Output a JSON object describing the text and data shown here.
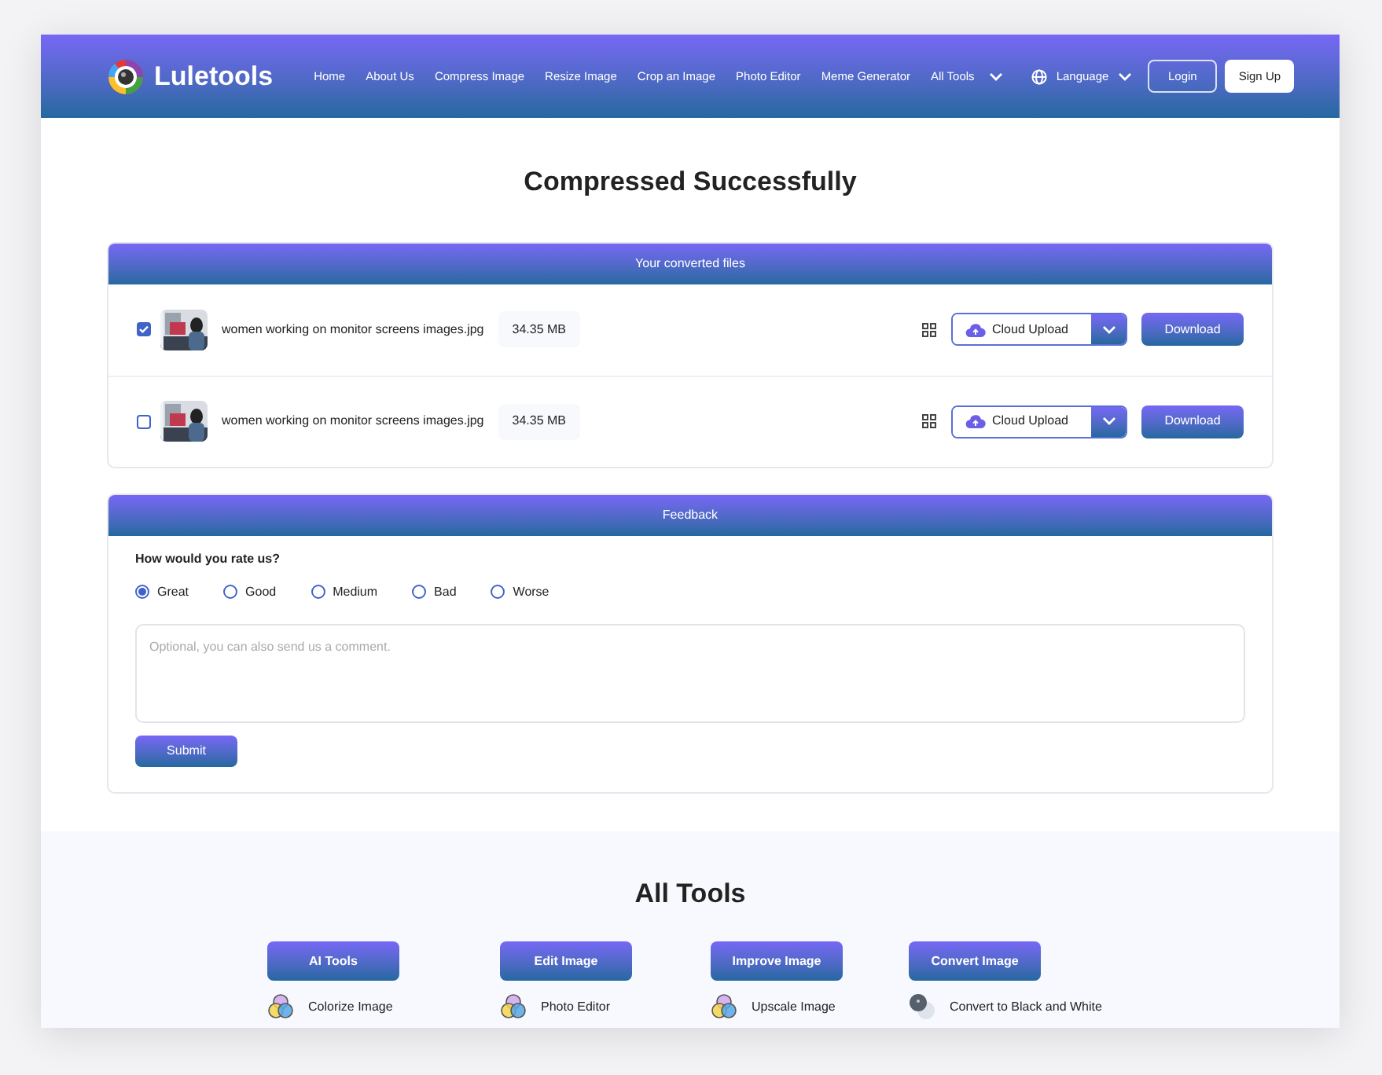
{
  "header": {
    "logo": "Luletools",
    "nav": [
      "Home",
      "About Us",
      "Compress Image",
      "Resize Image",
      "Crop an Image",
      "Photo Editor",
      "Meme Generator"
    ],
    "all_tools": "All Tools",
    "language": "Language",
    "login": "Login",
    "signup": "Sign Up"
  },
  "title": "Compressed Successfully",
  "files": {
    "heading": "Your converted files",
    "rows": [
      {
        "checked": true,
        "name": "women working on monitor screens images.jpg",
        "size": "34.35 MB",
        "upload": "Cloud Upload",
        "download": "Download"
      },
      {
        "checked": false,
        "name": "women working on monitor screens images.jpg",
        "size": "34.35 MB",
        "upload": "Cloud Upload",
        "download": "Download"
      }
    ]
  },
  "feedback": {
    "heading": "Feedback",
    "question": "How would you rate us?",
    "options": [
      {
        "label": "Great",
        "selected": true
      },
      {
        "label": "Good",
        "selected": false
      },
      {
        "label": "Medium",
        "selected": false
      },
      {
        "label": "Bad",
        "selected": false
      },
      {
        "label": "Worse",
        "selected": false
      }
    ],
    "comment": {
      "placeholder": "Optional, you can also send us a comment."
    },
    "submit": "Submit"
  },
  "tools": {
    "title": "All Tools",
    "categories": [
      {
        "label": "AI Tools",
        "item": {
          "label": "Colorize Image",
          "kind": "venn"
        }
      },
      {
        "label": "Edit Image",
        "item": {
          "label": "Photo Editor",
          "kind": "venn"
        }
      },
      {
        "label": "Improve Image",
        "item": {
          "label": "Upscale Image",
          "kind": "venn"
        }
      },
      {
        "label": "Convert Image",
        "item": {
          "label": "Convert to Black and White",
          "kind": "discs"
        }
      }
    ]
  }
}
